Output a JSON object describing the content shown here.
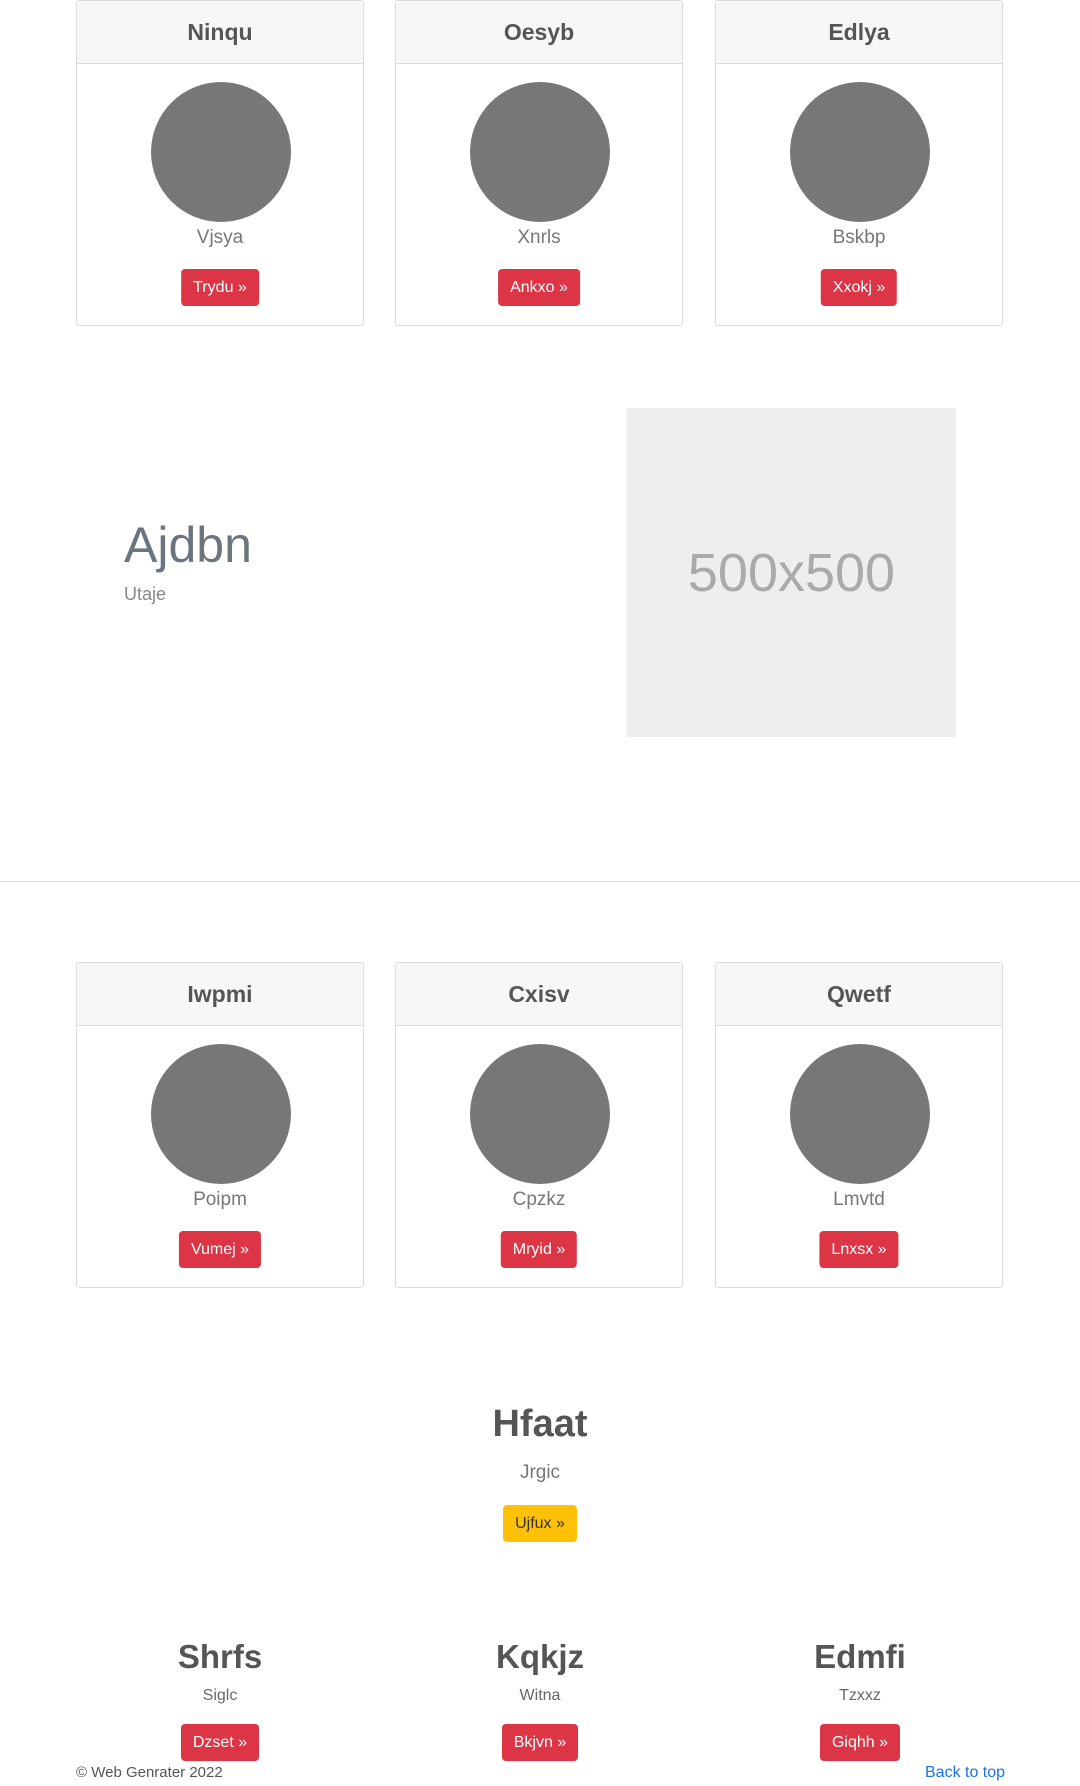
{
  "cards_top": [
    {
      "title": "Ninqu",
      "name": "Vjsya",
      "button": "Trydu »"
    },
    {
      "title": "Oesyb",
      "name": "Xnrls",
      "button": "Ankxo »"
    },
    {
      "title": "Edlya",
      "name": "Bskbp",
      "button": "Xxokj »"
    }
  ],
  "feature": {
    "title": "Ajdbn",
    "subtitle": "Utaje",
    "image_placeholder": "500x500"
  },
  "cards_bottom": [
    {
      "title": "Iwpmi",
      "name": "Poipm",
      "button": "Vumej »"
    },
    {
      "title": "Cxisv",
      "name": "Cpzkz",
      "button": "Mryid »"
    },
    {
      "title": "Qwetf",
      "name": "Lmvtd",
      "button": "Lnxsx »"
    }
  ],
  "center": {
    "title": "Hfaat",
    "subtitle": "Jrgic",
    "button": "Ujfux »"
  },
  "columns": [
    {
      "title": "Shrfs",
      "subtitle": "Siglc",
      "button": "Dzset »"
    },
    {
      "title": "Kqkjz",
      "subtitle": "Witna",
      "button": "Bkjvn »"
    },
    {
      "title": "Edmfi",
      "subtitle": "Tzxxz",
      "button": "Giqhh »"
    }
  ],
  "footer": {
    "copyright": "© Web Genrater 2022",
    "back_to_top": "Back to top"
  },
  "colors": {
    "button_red": "#dc3545",
    "button_yellow": "#ffc107",
    "avatar_gray": "#777777",
    "link_blue": "#1a73e8"
  }
}
